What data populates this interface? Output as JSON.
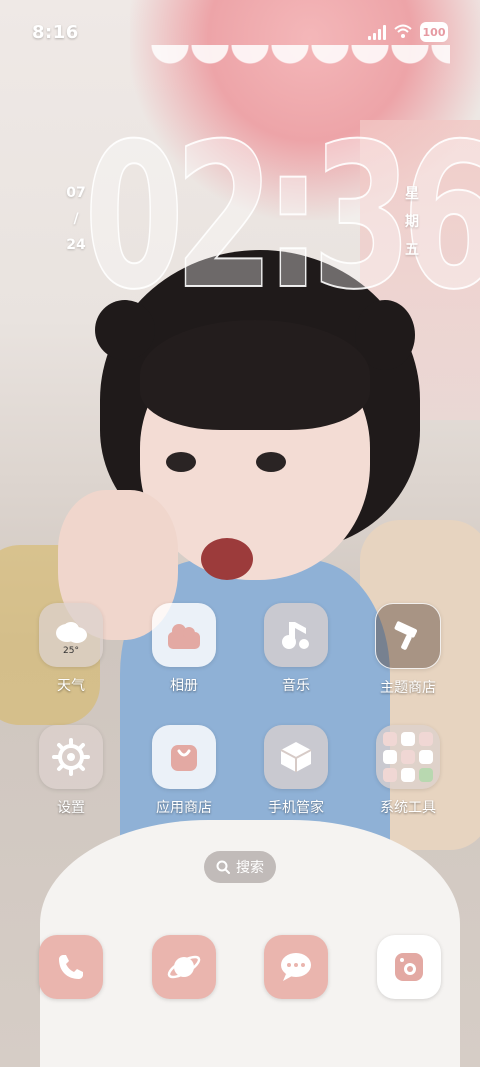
{
  "status_bar": {
    "time": "8:16",
    "battery": "100"
  },
  "clock": {
    "time": "02:36",
    "date_month": "07",
    "date_sep": "/",
    "date_day": "24",
    "weekday": [
      "星",
      "期",
      "五"
    ]
  },
  "apps": [
    {
      "label": "天气",
      "icon": "weather-icon",
      "badge": "25°"
    },
    {
      "label": "相册",
      "icon": "photos-icon"
    },
    {
      "label": "音乐",
      "icon": "music-icon"
    },
    {
      "label": "主题商店",
      "icon": "theme-store-icon"
    },
    {
      "label": "设置",
      "icon": "settings-gear-icon"
    },
    {
      "label": "应用商店",
      "icon": "app-store-icon"
    },
    {
      "label": "手机管家",
      "icon": "phone-manager-icon"
    },
    {
      "label": "系统工具",
      "icon": "system-tools-folder-icon"
    }
  ],
  "search": {
    "label": "搜索"
  },
  "dock": [
    {
      "icon": "phone-icon"
    },
    {
      "icon": "browser-planet-icon"
    },
    {
      "icon": "messages-icon"
    },
    {
      "icon": "camera-icon"
    }
  ],
  "colors": {
    "accent_pink": "#e7b3ae",
    "tile_white": "#ffffff",
    "icon_pink": "#e3a9a3"
  }
}
